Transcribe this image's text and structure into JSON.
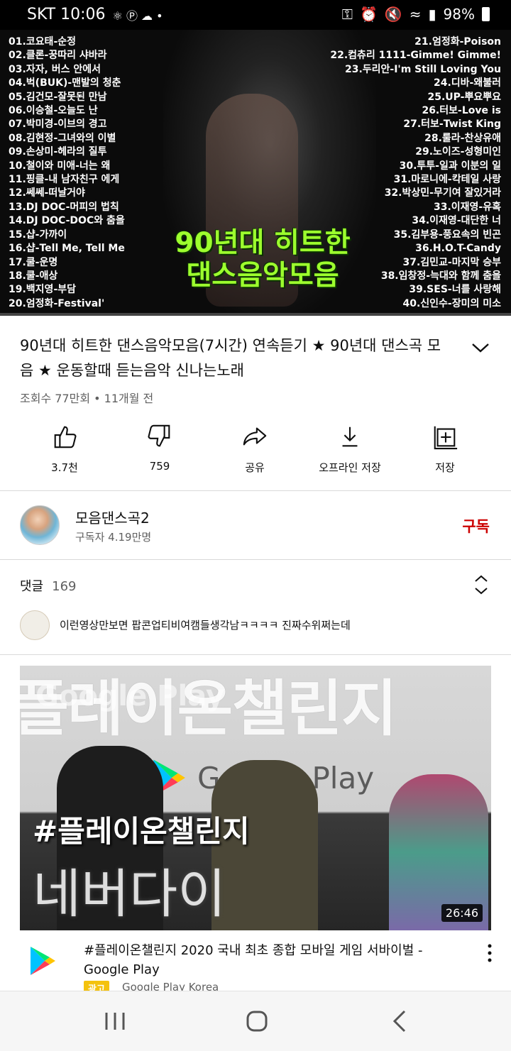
{
  "status_bar": {
    "carrier_time": "SKT 10:06",
    "battery": "98%"
  },
  "player": {
    "left_tracks": [
      "01.코요태-순정",
      "02.클론-꿍따리 샤바라",
      "03.자자, 버스 안에서",
      "04.벅(BUK)-맨발의 청춘",
      "05.김건모-잘못된 만남",
      "06.이승철-오늘도 난",
      "07.박미경-이브의 경고",
      "08.김현정-그녀와의 이별",
      "09.손상미-헤라의 질투",
      "10.철이와 미애-너는 왜",
      "11.핑클-내 남자친구 에게",
      "12.쎄쎄-떠날거야",
      "13.DJ DOC-머피의 법칙",
      "14.DJ DOC-DOC와 춤을",
      "15.샵-가까이",
      "16.샵-Tell Me, Tell Me",
      "17.쿨-운명",
      "18.쿨-애상",
      "19.백지영-부담",
      "20.엄정화-Festival'"
    ],
    "right_tracks": [
      "21.엄정화-Poison",
      "22.컴츄리 1111-Gimme! Gimme!",
      "23.두리안-I'm Still Loving You",
      "24.디바-왜불러",
      "25.UP-뿌요뿌요",
      "26.터보-Love is",
      "27.터보-Twist King",
      "28.룰라-찬상유애",
      "29.노이즈-성형미인",
      "30.투투-일과 이분의 일",
      "31.마로니에-칵테일 사랑",
      "32.박상민-무기여 잘있거라",
      "33.이재영-유혹",
      "34.이재영-대단한 너",
      "35.김부용-풍요속의 빈곤",
      "36.H.O.T-Candy",
      "37.김민교-마지막 승부",
      "38.임창정-늑대와 함께 춤을",
      "39.SES-너를 사랑해",
      "40.신인수-장미의 미소"
    ],
    "overlay_line1": "90년대 히트한",
    "overlay_line2": "댄스음악모음",
    "progress_fraction": 0.0
  },
  "video": {
    "title": "90년대 히트한 댄스음악모음(7시간) 연속듣기 ★ 90년대 댄스곡 모음 ★ 운동할때 듣는음악 신나는노래",
    "meta": "조회수 77만회 • 11개월 전"
  },
  "actions": {
    "like_label": "3.7천",
    "dislike_label": "759",
    "share_label": "공유",
    "offline_label": "오프라인 저장",
    "save_label": "저장"
  },
  "channel": {
    "name": "모음댄스곡2",
    "subscribers": "구독자 4.19만명",
    "subscribe_label": "구독"
  },
  "comments": {
    "header": "댓글",
    "count": "169",
    "first_comment": "이런영상만보면 팝콘업티비여캠들생각남ㅋㅋㅋㅋ 진짜수위쩌는데"
  },
  "ad": {
    "big_text": "플레이온챌린지",
    "watermark": "Google Play",
    "logo_text": "Google Play",
    "hashtag": "#플레이온챌린지",
    "subtitle": "네버다이",
    "duration": "26:46",
    "title": "#플레이온챌린지 2020 국내 최초 종합 모바일 게임 서바이벌 - Google Play",
    "badge": "광고",
    "advertiser": "Google Play Korea"
  }
}
